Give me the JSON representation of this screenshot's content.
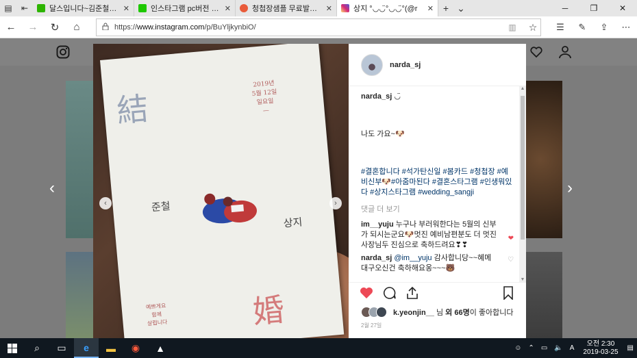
{
  "browser": {
    "tabs": [
      {
        "title": "달스입니다~김준철신랑님&",
        "favicon_color": "#2db400",
        "active": false
      },
      {
        "title": "인스타그램 pc버전 : 네이버",
        "favicon_color": "#1ec800",
        "active": false
      },
      {
        "title": "청첩장샘플 무료발송! 봄카",
        "favicon_color": "#e95b3a",
        "active": false
      },
      {
        "title": "상지 °◡◡̈°◡◡̈°(@r",
        "favicon_color": "#c13584",
        "active": true
      }
    ],
    "tab_close_glyph": "✕",
    "new_tab_glyph": "+",
    "tab_list_glyph": "⌄",
    "address": {
      "scheme": "https://",
      "host": "www.instagram.com",
      "path": "/p/BuYljkynbiO/"
    }
  },
  "post": {
    "username": "narda_sj",
    "caption_user": "narda_sj",
    "caption_emoji": "◡̈",
    "caption_text": "나도 가요~🐶",
    "hashtags": "#결혼합니다 #석가탄신일 #봄카드 #청첩장 #예비신부🐶#아줌마된다 #결혼스타그램 #인생뭐있다 #상지스타그램 #wedding_sangji",
    "view_more": "댓글 더 보기",
    "comments": [
      {
        "user": "im__yuju",
        "text": "누구나 부러워한다는 5월의 신부가 되시는군요🐶멋진 예비남편분도 더 멋진 사장님두 진심으로 축하드려요❣❣",
        "liked": true
      },
      {
        "user": "narda_sj",
        "mention": "@im__yuju",
        "text": "감사합니당~~혜메 대구오신건 축하해요옹~~~🐻",
        "liked": false
      }
    ],
    "likes_user": "k.yeonjin__",
    "likes_mid": "님",
    "likes_count": "외 66명",
    "likes_suffix": "이 좋아합니다",
    "date": "2월 27일",
    "card": {
      "hanja_top": "結",
      "hanja_bottom": "婚",
      "date_lines": [
        "2019년",
        "5월 12일",
        "일요일",
        "—"
      ],
      "groom": "준철",
      "bride": "상지",
      "note_lines": [
        "예쁘게요",
        "함께",
        "살렵니다"
      ]
    }
  },
  "taskbar": {
    "time": "오전 2:30",
    "date": "2019-03-25",
    "ime": "A"
  },
  "colors": {
    "like_red": "#ed4956",
    "hashtag_blue": "#003569",
    "overlay_gray": "#7c7c7c"
  }
}
